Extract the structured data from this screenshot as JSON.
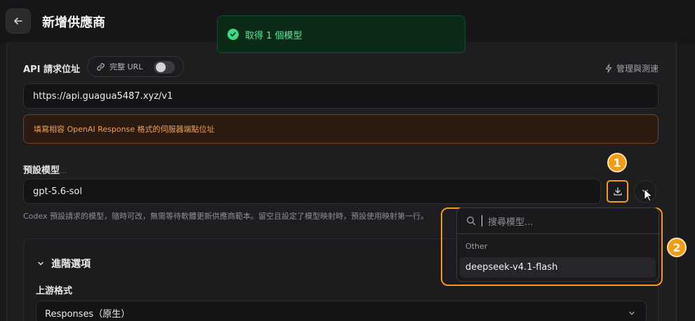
{
  "header": {
    "title": "新增供應商",
    "back_icon": "arrow-left-icon"
  },
  "toast": {
    "message": "取得 1 個模型",
    "icon": "check-circle-icon",
    "color": "#3ddc84"
  },
  "api_endpoint": {
    "label": "API 請求位址",
    "full_url_toggle_label": "完整 URL",
    "full_url_enabled": false,
    "manage_test_label": "管理與測速",
    "value": "https://api.guagua5487.xyz/v1",
    "warning": "填寫相容 OpenAI Response 格式的伺服器端點位址"
  },
  "default_model": {
    "label": "預設模型",
    "value": "gpt-5.6-sol",
    "help": "Codex 預設請求的模型，隨時可改，無需等待軟體更新供應商範本。留空且設定了模型映射時，預設使用映射第一行。",
    "fetch_button_icon": "download-icon",
    "toggle_button_icon": "chevron-down-icon"
  },
  "annotations": {
    "badge_1": "1",
    "badge_2": "2",
    "highlight_color": "#f39c12"
  },
  "model_dropdown": {
    "search_placeholder": "搜尋模型...",
    "group_label": "Other",
    "items": [
      "deepseek-v4.1-flash"
    ]
  },
  "advanced": {
    "title": "進階選項",
    "upstream_label": "上游格式",
    "upstream_value": "Responses（原生）"
  }
}
